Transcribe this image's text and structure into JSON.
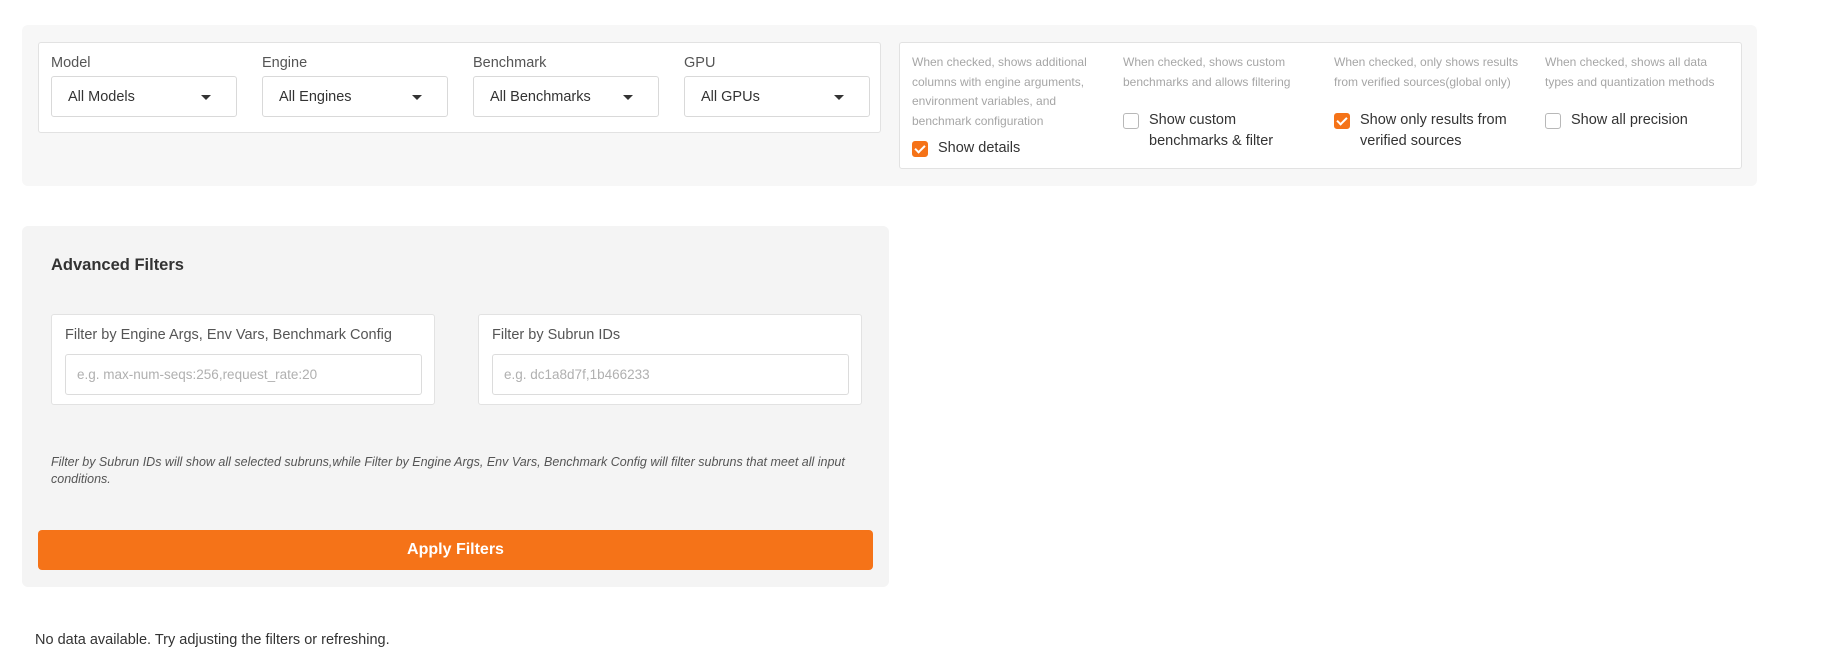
{
  "filters": {
    "model": {
      "label": "Model",
      "value": "All Models"
    },
    "engine": {
      "label": "Engine",
      "value": "All Engines"
    },
    "benchmark": {
      "label": "Benchmark",
      "value": "All Benchmarks"
    },
    "gpu": {
      "label": "GPU",
      "value": "All GPUs"
    }
  },
  "options": {
    "details": {
      "description": "When checked, shows additional columns with engine arguments, environment variables, and benchmark configuration",
      "label": "Show details",
      "checked": true
    },
    "custom": {
      "description": "When checked, shows custom benchmarks and allows filtering",
      "label": "Show custom benchmarks & filter",
      "checked": false
    },
    "verified": {
      "description": "When checked, only shows results from verified sources(global only)",
      "label": "Show only results from verified sources",
      "checked": true
    },
    "precision": {
      "description": "When checked, shows all data types and quantization methods",
      "label": "Show all precision",
      "checked": false
    }
  },
  "advanced": {
    "title": "Advanced Filters",
    "engine_args": {
      "label": "Filter by Engine Args, Env Vars, Benchmark Config",
      "placeholder": "e.g. max-num-seqs:256,request_rate:20",
      "value": ""
    },
    "subrun": {
      "label": "Filter by Subrun IDs",
      "placeholder": "e.g. dc1a8d7f,1b466233",
      "value": ""
    },
    "note": "Filter by Subrun IDs will show all selected subruns,while Filter by Engine Args, Env Vars, Benchmark Config will filter subruns that meet all input conditions.",
    "apply_label": "Apply Filters"
  },
  "status": {
    "empty_message": "No data available. Try adjusting the filters or refreshing."
  },
  "colors": {
    "accent": "#f57318",
    "panel_bg": "#f7f7f7"
  }
}
